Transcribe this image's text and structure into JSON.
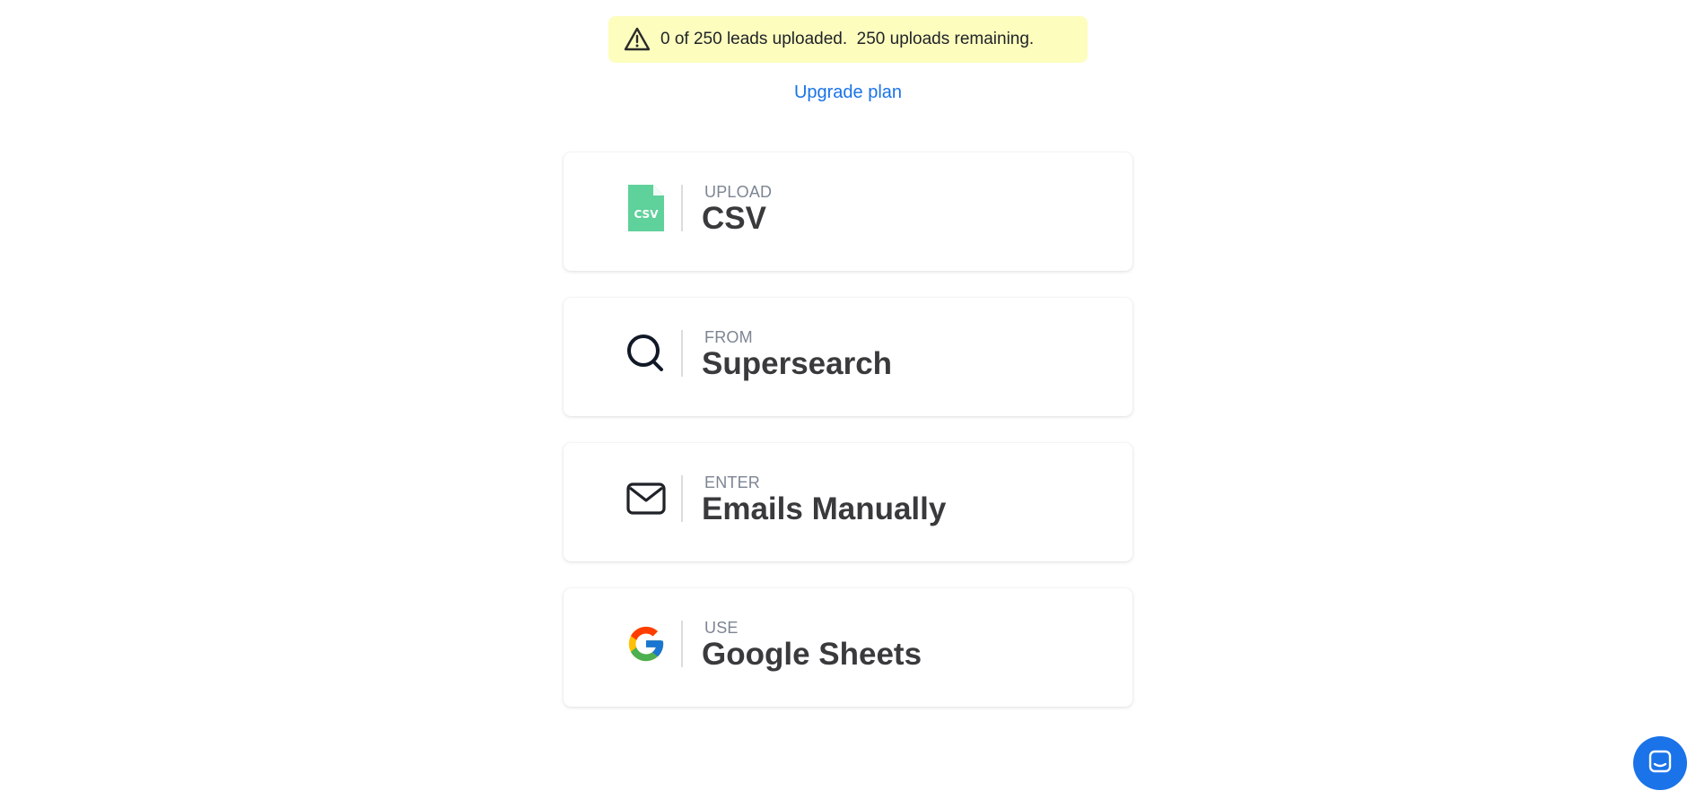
{
  "banner": {
    "icon": "warning-triangle-icon",
    "text": "0 of 250 leads uploaded.  250 uploads remaining.",
    "background": "#fdfdbe"
  },
  "upgrade": {
    "label": "Upgrade plan",
    "color": "#1a73e8"
  },
  "options": [
    {
      "icon": "csv-file-icon",
      "eyebrow": "UPLOAD",
      "title": "CSV",
      "icon_color": "#5fd19b"
    },
    {
      "icon": "search-icon",
      "eyebrow": "FROM",
      "title": "Supersearch"
    },
    {
      "icon": "mail-icon",
      "eyebrow": "ENTER",
      "title": "Emails Manually"
    },
    {
      "icon": "google-icon",
      "eyebrow": "USE",
      "title": "Google Sheets"
    }
  ],
  "chat": {
    "icon": "chat-icon",
    "color": "#1a73e8"
  }
}
